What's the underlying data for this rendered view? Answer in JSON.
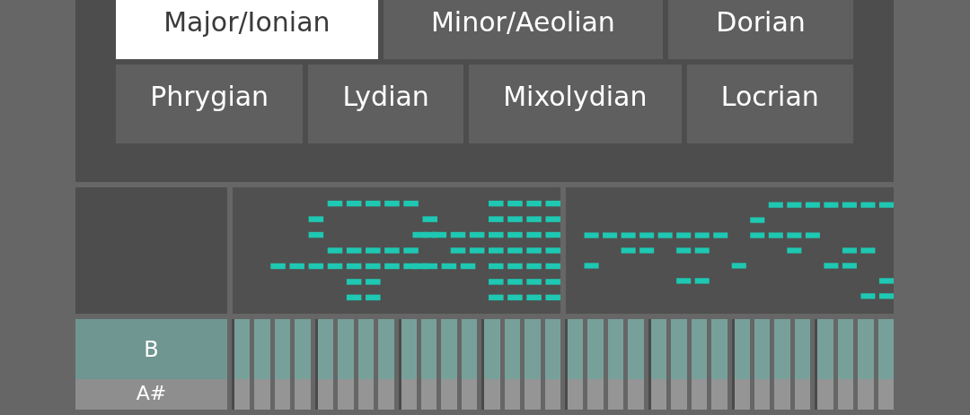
{
  "scale_buttons": [
    [
      {
        "label": "Major/Ionian",
        "selected": true
      },
      {
        "label": "Minor/Aeolian",
        "selected": false
      },
      {
        "label": "Dorian",
        "selected": false
      }
    ],
    [
      {
        "label": "Phrygian",
        "selected": false
      },
      {
        "label": "Lydian",
        "selected": false
      },
      {
        "label": "Mixolydian",
        "selected": false
      },
      {
        "label": "Locrian",
        "selected": false
      }
    ]
  ],
  "note_rows": [
    {
      "note": "B",
      "selected": true
    },
    {
      "note": "A#",
      "selected": false
    }
  ]
}
